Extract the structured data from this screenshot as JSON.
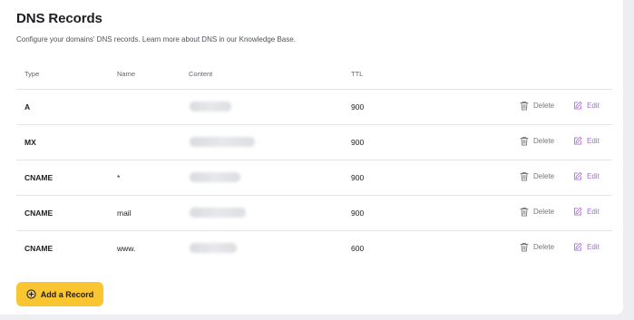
{
  "header": {
    "title": "DNS Records",
    "subtitle": "Configure your domains' DNS records. Learn more about DNS in our Knowledge Base."
  },
  "table": {
    "columns": [
      "Type",
      "Name",
      "Content",
      "TTL"
    ],
    "delete_label": "Delete",
    "edit_label": "Edit",
    "rows": [
      {
        "type": "A",
        "name": "",
        "content": "",
        "ttl": "900"
      },
      {
        "type": "MX",
        "name": "",
        "content": "",
        "ttl": "900"
      },
      {
        "type": "CNAME",
        "name": "*",
        "content": "",
        "ttl": "900"
      },
      {
        "type": "CNAME",
        "name": "mail",
        "content": "",
        "ttl": "900"
      },
      {
        "type": "CNAME",
        "name": "www.",
        "content": "",
        "ttl": "600"
      }
    ]
  },
  "actions": {
    "add_record_label": "Add a Record"
  },
  "icons": {
    "delete": "trash-icon",
    "edit": "edit-icon",
    "add": "plus-circle-icon"
  },
  "colors": {
    "accent": "#f9c531",
    "edit": "#a86bd9",
    "delete": "#74777d"
  }
}
